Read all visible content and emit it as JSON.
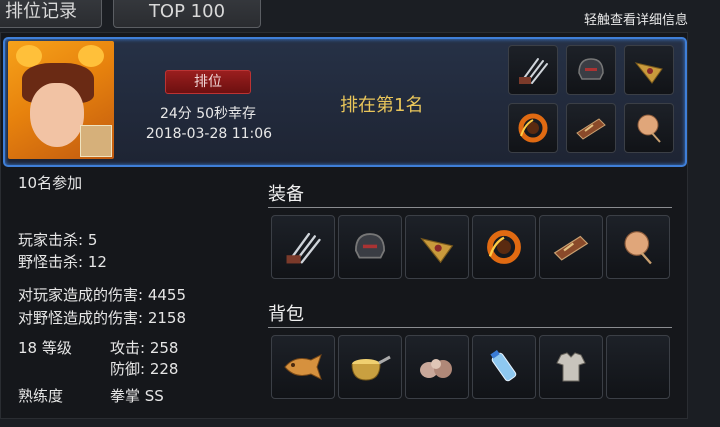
{
  "tabs": [
    {
      "label": "排位记录"
    },
    {
      "label": "TOP 100"
    }
  ],
  "hint": "轻触查看详细信息",
  "record": {
    "badge": "排位",
    "survival_time": "24分 50秒幸存",
    "datetime": "2018-03-28 11:06",
    "rank_text": "排在第1名",
    "card_items": [
      {
        "icon": "claw-icon"
      },
      {
        "icon": "dark-helmet-icon"
      },
      {
        "icon": "golden-plate-icon"
      },
      {
        "icon": "fire-ring-icon"
      },
      {
        "icon": "bracer-icon"
      },
      {
        "icon": "fan-icon"
      }
    ]
  },
  "stats": {
    "participants": "10名参加",
    "player_kills": "玩家击杀: 5",
    "monster_kills": "野怪击杀: 12",
    "player_damage": "对玩家造成的伤害: 4455",
    "monster_damage": "对野怪造成的伤害: 2158",
    "level": "18 等级",
    "attack": "攻击: 258",
    "defense": "防御: 228",
    "proficiency_label": "熟练度",
    "proficiency_value": "拳掌 SS"
  },
  "equipment": {
    "title": "装备",
    "items": [
      {
        "icon": "claw-icon"
      },
      {
        "icon": "dark-helmet-icon"
      },
      {
        "icon": "golden-plate-icon"
      },
      {
        "icon": "fire-ring-icon"
      },
      {
        "icon": "bracer-icon"
      },
      {
        "icon": "fan-icon"
      }
    ]
  },
  "backpack": {
    "title": "背包",
    "items": [
      {
        "icon": "fish-bun-icon"
      },
      {
        "icon": "pot-icon"
      },
      {
        "icon": "garlic-icon"
      },
      {
        "icon": "water-bottle-icon"
      },
      {
        "icon": "cloth-armor-icon"
      },
      {
        "icon": "empty-slot"
      }
    ]
  },
  "colors": {
    "card_border": "#3f7fd8",
    "rank_text": "#e8c55a",
    "badge_bg": "#9a1e1e"
  }
}
